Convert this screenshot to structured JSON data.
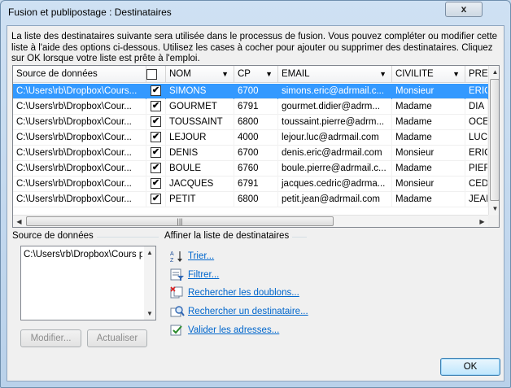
{
  "window": {
    "title": "Fusion et publipostage : Destinataires",
    "close_glyph": "x"
  },
  "description": "La liste des destinataires suivante sera utilisée dans le processus de fusion. Vous pouvez compléter ou modifier cette liste à l'aide des options ci-dessous. Utilisez les cases à cocher pour ajouter ou supprimer des destinataires. Cliquez sur OK lorsque votre liste est prête à l'emploi.",
  "grid": {
    "columns": [
      "Source de données",
      "",
      "NOM",
      "CP",
      "EMAIL",
      "CIVILITE",
      "PRE"
    ],
    "rows": [
      {
        "source": "C:\\Users\\rb\\Dropbox\\Cours...",
        "checked": true,
        "nom": "SIMONS",
        "cp": "6700",
        "email": "simons.eric@adrmail.c...",
        "civilite": "Monsieur",
        "prenom": "ERIC",
        "selected": true
      },
      {
        "source": "C:\\Users\\rb\\Dropbox\\Cour...",
        "checked": true,
        "nom": "GOURMET",
        "cp": "6791",
        "email": "gourmet.didier@adrm...",
        "civilite": "Madame",
        "prenom": "DIA",
        "selected": false
      },
      {
        "source": "C:\\Users\\rb\\Dropbox\\Cour...",
        "checked": true,
        "nom": "TOUSSAINT",
        "cp": "6800",
        "email": "toussaint.pierre@adrm...",
        "civilite": "Madame",
        "prenom": "OCE",
        "selected": false
      },
      {
        "source": "C:\\Users\\rb\\Dropbox\\Cour...",
        "checked": true,
        "nom": "LEJOUR",
        "cp": "4000",
        "email": "lejour.luc@adrmail.com",
        "civilite": "Madame",
        "prenom": "LUC",
        "selected": false
      },
      {
        "source": "C:\\Users\\rb\\Dropbox\\Cour...",
        "checked": true,
        "nom": "DENIS",
        "cp": "6700",
        "email": "denis.eric@adrmail.com",
        "civilite": "Monsieur",
        "prenom": "ERIC",
        "selected": false
      },
      {
        "source": "C:\\Users\\rb\\Dropbox\\Cour...",
        "checked": true,
        "nom": "BOULE",
        "cp": "6760",
        "email": "boule.pierre@adrmail.c...",
        "civilite": "Madame",
        "prenom": "PIEF",
        "selected": false
      },
      {
        "source": "C:\\Users\\rb\\Dropbox\\Cour...",
        "checked": true,
        "nom": "JACQUES",
        "cp": "6791",
        "email": "jacques.cedric@adrma...",
        "civilite": "Monsieur",
        "prenom": "CED",
        "selected": false
      },
      {
        "source": "C:\\Users\\rb\\Dropbox\\Cour...",
        "checked": true,
        "nom": "PETIT",
        "cp": "6800",
        "email": "petit.jean@adrmail.com",
        "civilite": "Madame",
        "prenom": "JEAI",
        "selected": false
      }
    ],
    "check_glyph": "✔"
  },
  "datasource": {
    "label": "Source de données",
    "item": "C:\\Users\\rb\\Dropbox\\Cours pa"
  },
  "refine": {
    "label": "Affiner la liste de destinataires",
    "links": [
      {
        "text": "Trier...",
        "icon": "sort-az-icon"
      },
      {
        "text": "Filtrer...",
        "icon": "filter-icon"
      },
      {
        "text": "Rechercher les doublons...",
        "icon": "duplicates-icon"
      },
      {
        "text": "Rechercher un destinataire...",
        "icon": "find-recipient-icon"
      },
      {
        "text": "Valider les adresses...",
        "icon": "validate-addresses-icon"
      }
    ]
  },
  "buttons": {
    "modify": "Modifier...",
    "refresh": "Actualiser",
    "ok": "OK"
  },
  "colors": {
    "selection": "#3399ff",
    "link": "#0066cc"
  }
}
